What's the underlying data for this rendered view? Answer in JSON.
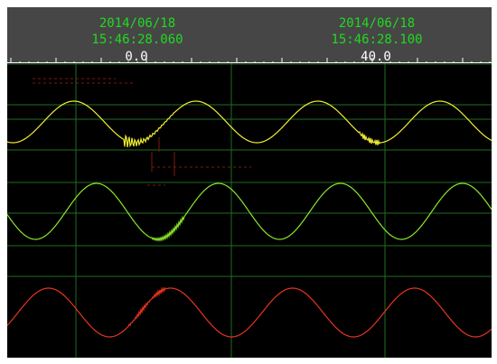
{
  "header": {
    "left_cursor": {
      "date": "2014/06/18",
      "time": "15:46:28.060",
      "value": "0.0"
    },
    "right_cursor": {
      "date": "2014/06/18",
      "time": "15:46:28.100",
      "value": "40.0"
    }
  },
  "colors": {
    "header_bg": "#464646",
    "timestamp": "#21d921",
    "cursor_value": "#ffffff",
    "plot_bg": "#000000",
    "grid": "#1f6e1f",
    "ruler": "#ffffff",
    "channel_1": "#f2ee33",
    "channel_2": "#8ae62a",
    "channel_3": "#e8341f",
    "residue": "#7a1a12"
  },
  "channels": [
    {
      "id": "ch1",
      "color_key": "channel_1",
      "description_icon": "yellow-waveform"
    },
    {
      "id": "ch2",
      "color_key": "channel_2",
      "description_icon": "green-waveform"
    },
    {
      "id": "ch3",
      "color_key": "channel_3",
      "description_icon": "red-waveform"
    }
  ]
}
